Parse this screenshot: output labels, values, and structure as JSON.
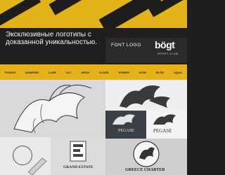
{
  "hero": {
    "headline": "Эксклюзивные логотипы с доказанной уникальностью.",
    "font_logo_label": "FONT LOGO",
    "brand_mark": "bögt",
    "brand_sub": "SPORT CLUB"
  },
  "logo_strip": {
    "items": [
      "FUSION",
      "DIAMOND",
      "LUXE",
      "ALT",
      "ARCH",
      "CLASS",
      "POWER",
      "ICON",
      "ELITE",
      "AQUA"
    ]
  },
  "gallery": {
    "pegase_label_dark": "PEGASE",
    "pegase_label_light": "PEGASE",
    "grand_estate_label": "GRAND ESTATE",
    "greece_label": "GREECE CHARTER"
  },
  "colors": {
    "accent_yellow": "#e6b21c",
    "dark_bg": "#1e1e1e"
  }
}
